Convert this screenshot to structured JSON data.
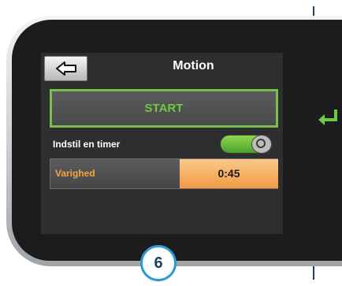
{
  "screen": {
    "title": "Motion",
    "back_icon": "arrow-left-icon",
    "start_label": "START",
    "timer_label": "Indstil en timer",
    "timer_enabled": true,
    "duration_label": "Varighed",
    "duration_value": "0:45"
  },
  "annotations": {
    "enter_icon": "enter-return-icon",
    "step_number": "6"
  },
  "colors": {
    "accent_green": "#6ec845",
    "accent_orange": "#f29a45",
    "badge_blue": "#2f9ad3"
  }
}
